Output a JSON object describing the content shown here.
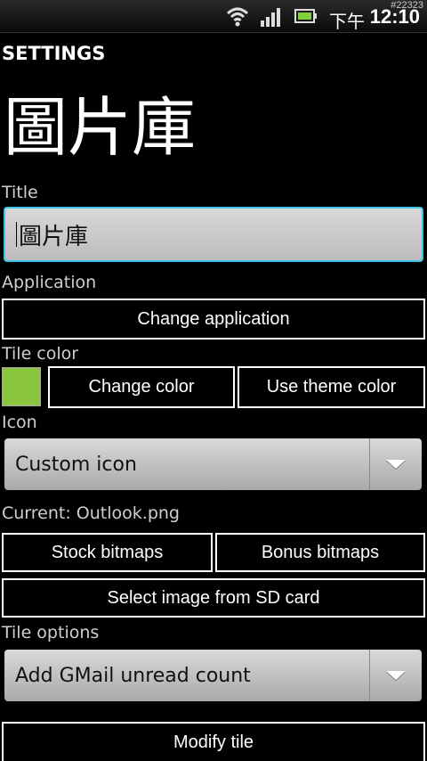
{
  "status_bar": {
    "id_text": "#22323",
    "ampm": "下午",
    "time": "12:10",
    "icons": [
      "wifi-icon",
      "signal-icon",
      "battery-icon"
    ]
  },
  "header": {
    "settings_label": "SETTINGS",
    "tile_title": "圖片庫"
  },
  "title_section": {
    "label": "Title",
    "input_value": "圖片庫"
  },
  "application_section": {
    "label": "Application",
    "change_button": "Change application"
  },
  "tile_color_section": {
    "label": "Tile color",
    "swatch_color": "#8bc43f",
    "change_color_button": "Change color",
    "theme_color_button": "Use theme color"
  },
  "icon_section": {
    "label": "Icon",
    "spinner_value": "Custom icon",
    "current_text": "Current: Outlook.png",
    "stock_button": "Stock bitmaps",
    "bonus_button": "Bonus bitmaps",
    "sd_button": "Select image from SD card"
  },
  "tile_options_section": {
    "label": "Tile options",
    "spinner_value": "Add GMail unread count"
  },
  "footer": {
    "modify_button": "Modify tile"
  },
  "colors": {
    "focus_border": "#3ec4e6",
    "tile_green": "#8bc43f"
  }
}
